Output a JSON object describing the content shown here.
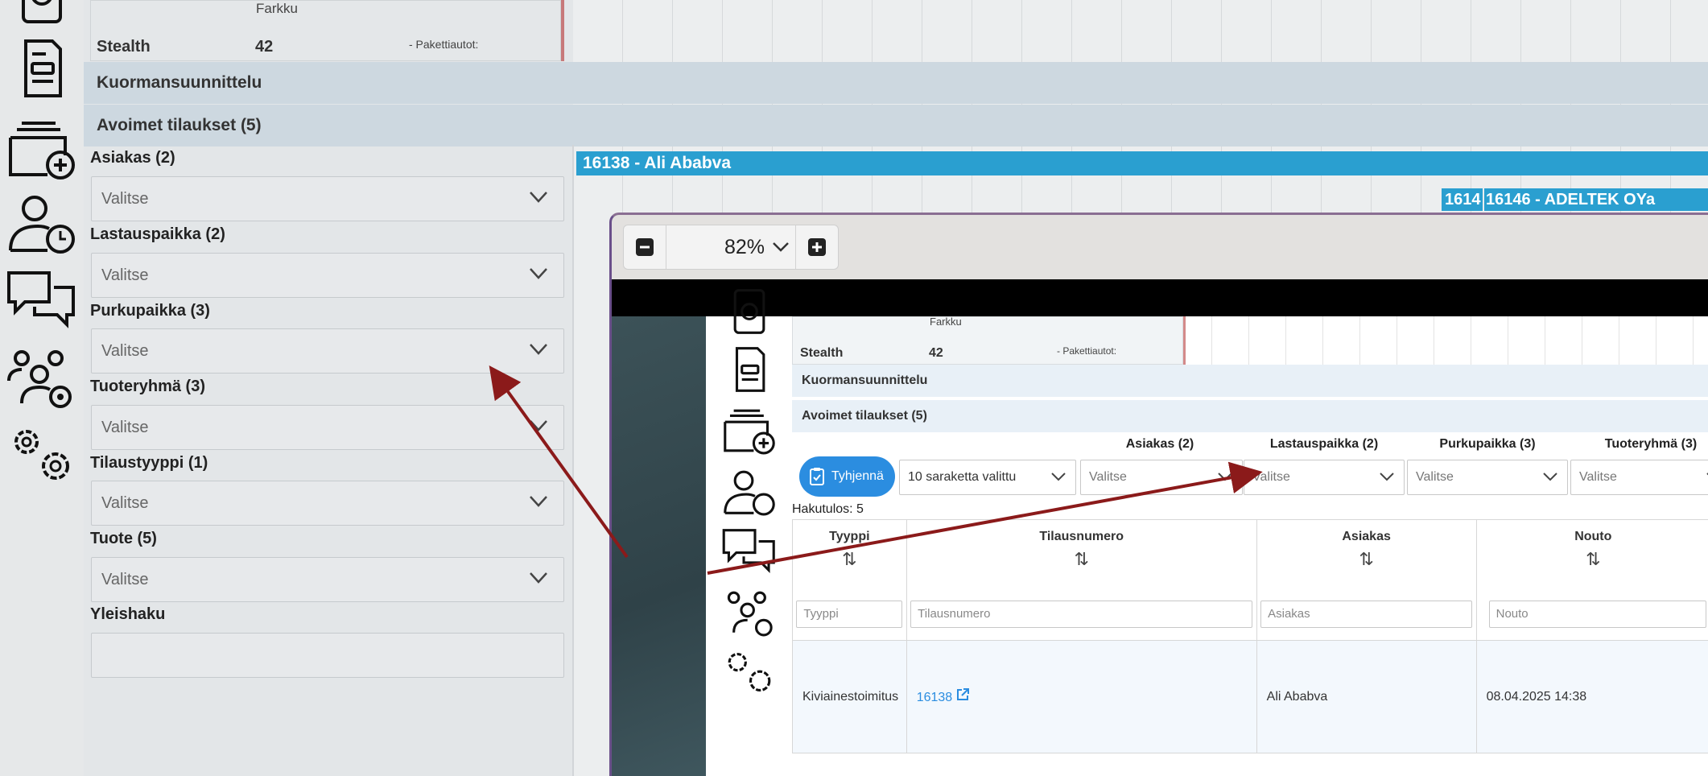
{
  "background": {
    "partial_row_top_text": "Farkku",
    "partial_row_name": "Stealth",
    "partial_row_value": "42",
    "partial_row_note": "- Pakettiautot:",
    "section_planning": "Kuormansuunnittelu",
    "section_open_orders": "Avoimet tilaukset (5)",
    "filters": [
      {
        "label": "Asiakas (2)",
        "placeholder": "Valitse"
      },
      {
        "label": "Lastauspaikka (2)",
        "placeholder": "Valitse"
      },
      {
        "label": "Purkupaikka (3)",
        "placeholder": "Valitse"
      },
      {
        "label": "Tuoteryhmä (3)",
        "placeholder": "Valitse"
      },
      {
        "label": "Tilaustyyppi (1)",
        "placeholder": "Valitse"
      },
      {
        "label": "Tuote (5)",
        "placeholder": "Valitse"
      }
    ],
    "search_label": "Yleishaku",
    "gantt_bar_1": "16138 - Ali Ababva",
    "gantt_bar_2a": "1614",
    "gantt_bar_2b": "16146 - ADELTEK OYa"
  },
  "sidebar_icons": [
    "history-icon",
    "document-icon",
    "add-folder-icon",
    "user-clock-icon",
    "chat-icon",
    "users-settings-icon",
    "settings-icon"
  ],
  "zoom": {
    "level": "82%"
  },
  "inner": {
    "partial_row_top_text": "Farkku",
    "partial_row_name": "Stealth",
    "partial_row_value": "42",
    "partial_row_note": "- Pakettiautot:",
    "section_planning": "Kuormansuunnittelu",
    "section_open_orders": "Avoimet tilaukset (5)",
    "clear_button": "Tyhjennä",
    "columns_select": "10 saraketta valittu",
    "filters": [
      {
        "label": "Asiakas (2)",
        "placeholder": "Valitse"
      },
      {
        "label": "Lastauspaikka (2)",
        "placeholder": "Valitse"
      },
      {
        "label": "Purkupaikka (3)",
        "placeholder": "Valitse"
      },
      {
        "label": "Tuoteryhmä (3)",
        "placeholder": "Valitse"
      }
    ],
    "result_count": "Hakutulos: 5",
    "table": {
      "columns": [
        {
          "header": "Tyyppi",
          "filter_placeholder": "Tyyppi"
        },
        {
          "header": "Tilausnumero",
          "filter_placeholder": "Tilausnumero"
        },
        {
          "header": "Asiakas",
          "filter_placeholder": "Asiakas"
        },
        {
          "header": "Nouto",
          "filter_placeholder": "Nouto"
        }
      ],
      "rows": [
        {
          "type": "Kiviainestoimitus",
          "order": "16138",
          "customer": "Ali Ababva",
          "pickup": "08.04.2025 14:38"
        }
      ]
    }
  },
  "colors": {
    "accent": "#2b8de0",
    "gantt_bar": "#2a9fd0",
    "annotation_arrow": "#8b1a1a"
  }
}
